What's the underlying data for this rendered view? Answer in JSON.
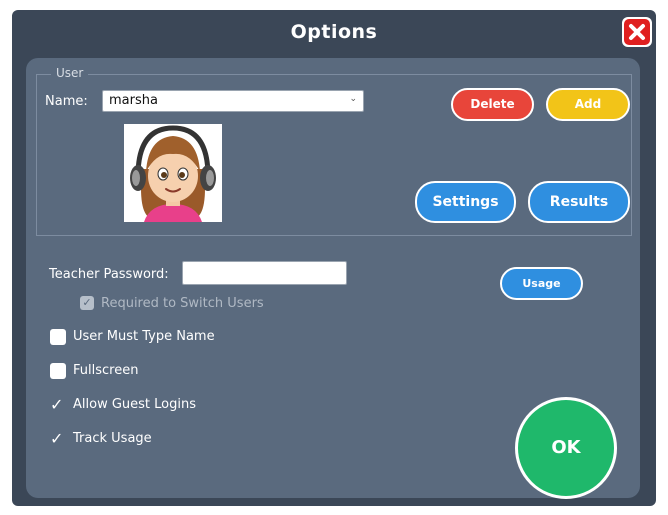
{
  "window": {
    "title": "Options"
  },
  "user_group": {
    "legend": "User",
    "name_label": "Name:",
    "selected_user": "marsha",
    "buttons": {
      "delete": "Delete",
      "add": "Add",
      "settings": "Settings",
      "results": "Results"
    }
  },
  "teacher": {
    "password_label": "Teacher Password:",
    "password_value": "",
    "required_label": "Required to Switch Users",
    "required_checked": true
  },
  "usage_button": "Usage",
  "options": [
    {
      "label": "User Must Type Name",
      "checked": false
    },
    {
      "label": "Fullscreen",
      "checked": false
    },
    {
      "label": "Allow Guest Logins",
      "checked": true
    },
    {
      "label": "Track Usage",
      "checked": true
    }
  ],
  "ok_button": "OK",
  "colors": {
    "titlebar": "#3b4757",
    "panel": "#5a6a7e",
    "delete": "#e8453a",
    "add": "#f2c418",
    "blue": "#2f8fe0",
    "ok": "#1fb86b",
    "close": "#e02020"
  }
}
